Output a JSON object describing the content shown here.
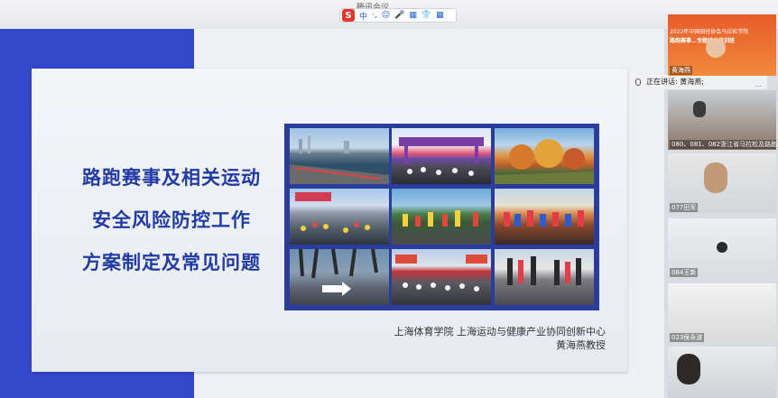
{
  "window": {
    "title": "腾讯会议"
  },
  "ime_toolbar": {
    "items": [
      {
        "name": "lang-toggle",
        "label": "中"
      },
      {
        "name": "punct-toggle",
        "label": "·,"
      },
      {
        "name": "emoji-icon",
        "label": "☺"
      },
      {
        "name": "mic-icon",
        "label": "🎤"
      },
      {
        "name": "keyboard-icon",
        "label": "▦"
      },
      {
        "name": "skin-icon",
        "label": "👕"
      },
      {
        "name": "grid-menu-icon",
        "label": "▦"
      }
    ]
  },
  "slide": {
    "title_lines": [
      "路跑赛事及相关运动",
      "安全风险防控工作",
      "方案制定及常见问题"
    ],
    "credit_line1": "上海体育学院 上海运动与健康产业协同创新中心",
    "credit_line2": "黄海燕教授"
  },
  "speaking_bar": {
    "text": "正在讲话: 黄海燕;"
  },
  "participants": [
    {
      "name": "黄海燕",
      "banner_line1": "2022年中国田径协会马拉松学院",
      "banner_line2": "路跑赛事…专题线上培训班"
    },
    {
      "name": "080、081、082浙江省马拉松及路跑"
    },
    {
      "name": "077田军"
    },
    {
      "name": "084王新"
    },
    {
      "name": "023侯永波"
    },
    {
      "name": ""
    }
  ],
  "colors": {
    "accent_blue": "#3446c9",
    "title_blue": "#223aa8"
  }
}
